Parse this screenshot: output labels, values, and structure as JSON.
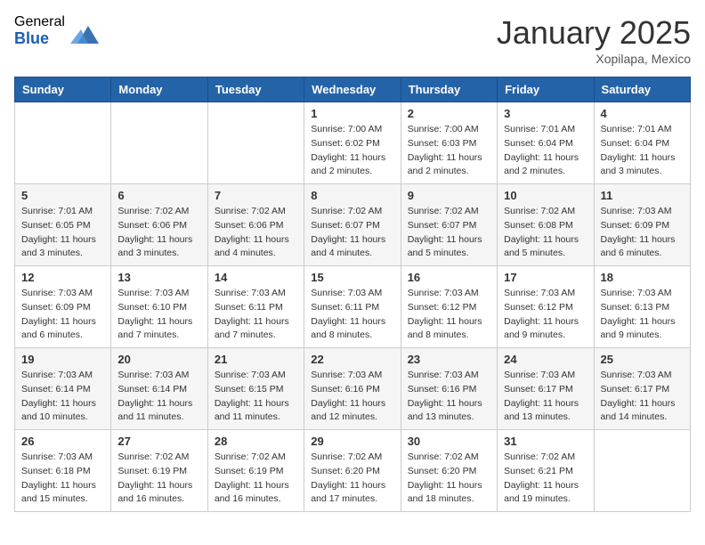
{
  "header": {
    "logo_general": "General",
    "logo_blue": "Blue",
    "month_title": "January 2025",
    "location": "Xopilapa, Mexico"
  },
  "weekdays": [
    "Sunday",
    "Monday",
    "Tuesday",
    "Wednesday",
    "Thursday",
    "Friday",
    "Saturday"
  ],
  "weeks": [
    [
      {
        "day": "",
        "info": ""
      },
      {
        "day": "",
        "info": ""
      },
      {
        "day": "",
        "info": ""
      },
      {
        "day": "1",
        "info": "Sunrise: 7:00 AM\nSunset: 6:02 PM\nDaylight: 11 hours\nand 2 minutes."
      },
      {
        "day": "2",
        "info": "Sunrise: 7:00 AM\nSunset: 6:03 PM\nDaylight: 11 hours\nand 2 minutes."
      },
      {
        "day": "3",
        "info": "Sunrise: 7:01 AM\nSunset: 6:04 PM\nDaylight: 11 hours\nand 2 minutes."
      },
      {
        "day": "4",
        "info": "Sunrise: 7:01 AM\nSunset: 6:04 PM\nDaylight: 11 hours\nand 3 minutes."
      }
    ],
    [
      {
        "day": "5",
        "info": "Sunrise: 7:01 AM\nSunset: 6:05 PM\nDaylight: 11 hours\nand 3 minutes."
      },
      {
        "day": "6",
        "info": "Sunrise: 7:02 AM\nSunset: 6:06 PM\nDaylight: 11 hours\nand 3 minutes."
      },
      {
        "day": "7",
        "info": "Sunrise: 7:02 AM\nSunset: 6:06 PM\nDaylight: 11 hours\nand 4 minutes."
      },
      {
        "day": "8",
        "info": "Sunrise: 7:02 AM\nSunset: 6:07 PM\nDaylight: 11 hours\nand 4 minutes."
      },
      {
        "day": "9",
        "info": "Sunrise: 7:02 AM\nSunset: 6:07 PM\nDaylight: 11 hours\nand 5 minutes."
      },
      {
        "day": "10",
        "info": "Sunrise: 7:02 AM\nSunset: 6:08 PM\nDaylight: 11 hours\nand 5 minutes."
      },
      {
        "day": "11",
        "info": "Sunrise: 7:03 AM\nSunset: 6:09 PM\nDaylight: 11 hours\nand 6 minutes."
      }
    ],
    [
      {
        "day": "12",
        "info": "Sunrise: 7:03 AM\nSunset: 6:09 PM\nDaylight: 11 hours\nand 6 minutes."
      },
      {
        "day": "13",
        "info": "Sunrise: 7:03 AM\nSunset: 6:10 PM\nDaylight: 11 hours\nand 7 minutes."
      },
      {
        "day": "14",
        "info": "Sunrise: 7:03 AM\nSunset: 6:11 PM\nDaylight: 11 hours\nand 7 minutes."
      },
      {
        "day": "15",
        "info": "Sunrise: 7:03 AM\nSunset: 6:11 PM\nDaylight: 11 hours\nand 8 minutes."
      },
      {
        "day": "16",
        "info": "Sunrise: 7:03 AM\nSunset: 6:12 PM\nDaylight: 11 hours\nand 8 minutes."
      },
      {
        "day": "17",
        "info": "Sunrise: 7:03 AM\nSunset: 6:12 PM\nDaylight: 11 hours\nand 9 minutes."
      },
      {
        "day": "18",
        "info": "Sunrise: 7:03 AM\nSunset: 6:13 PM\nDaylight: 11 hours\nand 9 minutes."
      }
    ],
    [
      {
        "day": "19",
        "info": "Sunrise: 7:03 AM\nSunset: 6:14 PM\nDaylight: 11 hours\nand 10 minutes."
      },
      {
        "day": "20",
        "info": "Sunrise: 7:03 AM\nSunset: 6:14 PM\nDaylight: 11 hours\nand 11 minutes."
      },
      {
        "day": "21",
        "info": "Sunrise: 7:03 AM\nSunset: 6:15 PM\nDaylight: 11 hours\nand 11 minutes."
      },
      {
        "day": "22",
        "info": "Sunrise: 7:03 AM\nSunset: 6:16 PM\nDaylight: 11 hours\nand 12 minutes."
      },
      {
        "day": "23",
        "info": "Sunrise: 7:03 AM\nSunset: 6:16 PM\nDaylight: 11 hours\nand 13 minutes."
      },
      {
        "day": "24",
        "info": "Sunrise: 7:03 AM\nSunset: 6:17 PM\nDaylight: 11 hours\nand 13 minutes."
      },
      {
        "day": "25",
        "info": "Sunrise: 7:03 AM\nSunset: 6:17 PM\nDaylight: 11 hours\nand 14 minutes."
      }
    ],
    [
      {
        "day": "26",
        "info": "Sunrise: 7:03 AM\nSunset: 6:18 PM\nDaylight: 11 hours\nand 15 minutes."
      },
      {
        "day": "27",
        "info": "Sunrise: 7:02 AM\nSunset: 6:19 PM\nDaylight: 11 hours\nand 16 minutes."
      },
      {
        "day": "28",
        "info": "Sunrise: 7:02 AM\nSunset: 6:19 PM\nDaylight: 11 hours\nand 16 minutes."
      },
      {
        "day": "29",
        "info": "Sunrise: 7:02 AM\nSunset: 6:20 PM\nDaylight: 11 hours\nand 17 minutes."
      },
      {
        "day": "30",
        "info": "Sunrise: 7:02 AM\nSunset: 6:20 PM\nDaylight: 11 hours\nand 18 minutes."
      },
      {
        "day": "31",
        "info": "Sunrise: 7:02 AM\nSunset: 6:21 PM\nDaylight: 11 hours\nand 19 minutes."
      },
      {
        "day": "",
        "info": ""
      }
    ]
  ]
}
